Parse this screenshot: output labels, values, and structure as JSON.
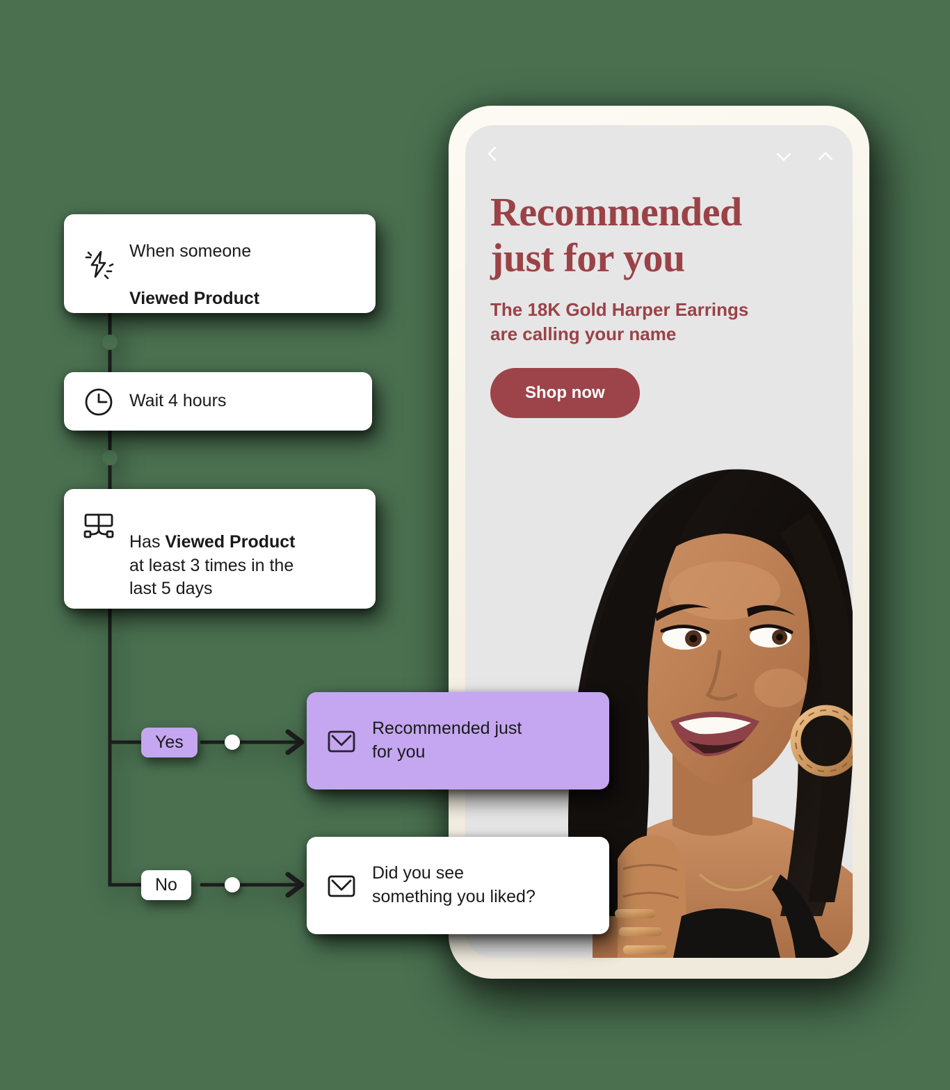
{
  "background_color": "#4a7050",
  "flow": {
    "nodes": [
      {
        "id": "trigger",
        "icon": "lightning-bolt-icon",
        "line1": "When someone",
        "line2": "Viewed Product"
      },
      {
        "id": "wait",
        "icon": "clock-icon",
        "label": "Wait 4 hours"
      },
      {
        "id": "condition",
        "icon": "conditional-split-icon",
        "prefix": "Has ",
        "strong": "Viewed Product",
        "rest": "at least 3 times in the\nlast 5 days"
      }
    ],
    "branches": [
      {
        "id": "yes",
        "label": "Yes",
        "badge_color": "#c4a7f0"
      },
      {
        "id": "no",
        "label": "No",
        "badge_color": "#ffffff"
      }
    ],
    "emails": [
      {
        "id": "email-yes",
        "icon": "envelope-icon",
        "label": "Recommended just\nfor you",
        "card_color": "#c4a7f0"
      },
      {
        "id": "email-no",
        "icon": "envelope-icon",
        "label": "Did you see\nsomething you liked?",
        "card_color": "#ffffff"
      }
    ]
  },
  "phone": {
    "nav": {
      "back_icon": "chevron-left-icon",
      "down_icon": "chevron-down-icon",
      "up_icon": "chevron-up-icon"
    },
    "promo": {
      "headline": "Recommended\njust for you",
      "subhead": "The 18K Gold Harper Earrings\nare calling your name",
      "cta_label": "Shop now",
      "accent_color": "#9b4247",
      "cta_color": "#9c4449",
      "screen_bg": "#e6e6e6"
    },
    "photo_alt": "smiling-model-wearing-gold-hoop-earrings"
  }
}
